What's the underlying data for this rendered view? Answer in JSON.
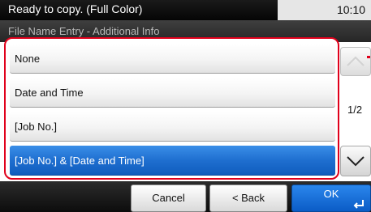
{
  "status": {
    "message": "Ready to copy. (Full Color)",
    "time": "10:10"
  },
  "screen_title": "File Name Entry - Additional Info",
  "options": [
    {
      "label": "None",
      "selected": false
    },
    {
      "label": "Date and Time",
      "selected": false
    },
    {
      "label": "[Job No.]",
      "selected": false
    },
    {
      "label": "[Job No.] & [Date and Time]",
      "selected": true
    }
  ],
  "pagination": {
    "indicator": "1/2"
  },
  "buttons": {
    "cancel": "Cancel",
    "back": "< Back",
    "ok": "OK"
  },
  "colors": {
    "highlight": "#e0001b",
    "selection": "#1f6fd0"
  },
  "icons": {
    "scroll_up": "chevron-up-icon",
    "scroll_down": "chevron-down-icon",
    "ok_enter": "enter-icon"
  }
}
